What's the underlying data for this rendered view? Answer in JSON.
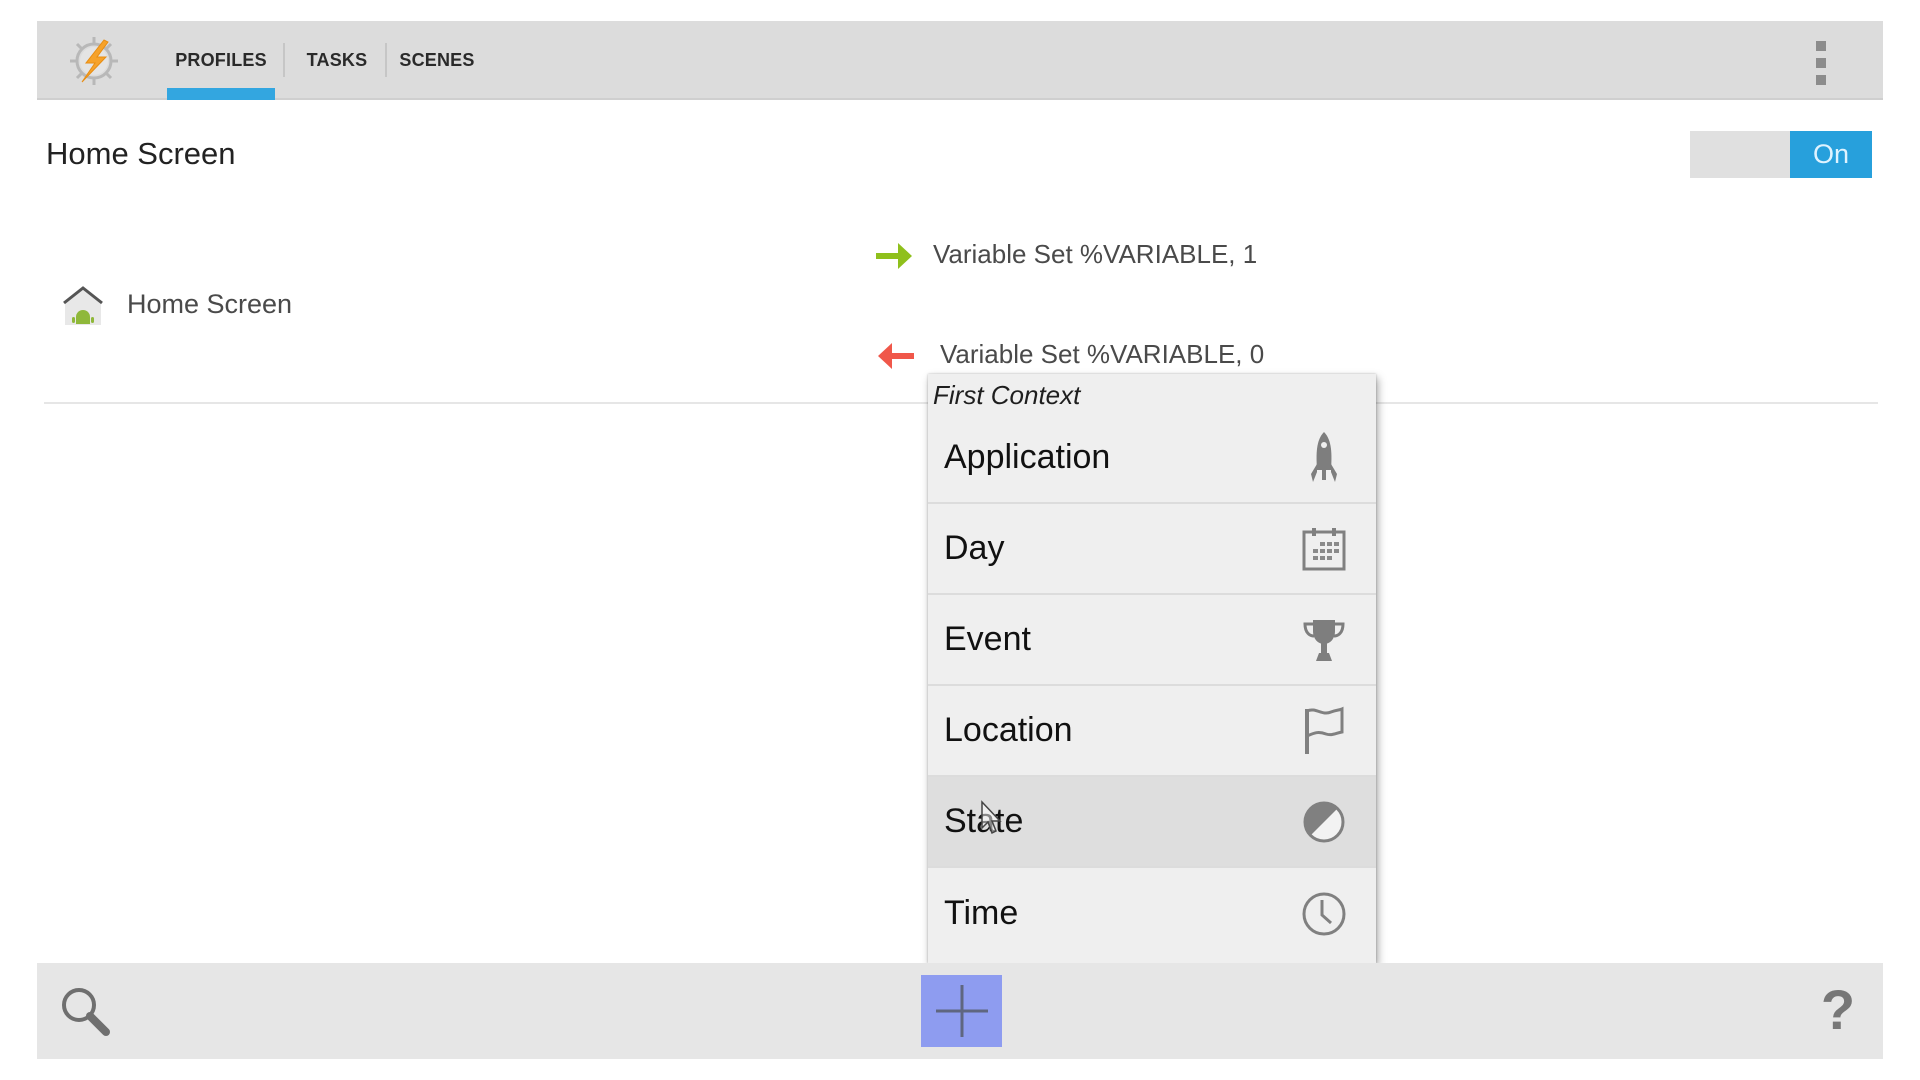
{
  "app": {
    "tabs": [
      {
        "label": "PROFILES",
        "active": true
      },
      {
        "label": "TASKS",
        "active": false
      },
      {
        "label": "SCENES",
        "active": false
      }
    ],
    "accent_color": "#33a6e0",
    "overflow_icon": "more-vert-icon"
  },
  "profile": {
    "title": "Home Screen",
    "toggle_label": "On",
    "toggle_state": true,
    "context": {
      "icon": "home-android-icon",
      "label": "Home Screen"
    },
    "enter_task": {
      "icon": "arrow-right-green-icon",
      "label": "Variable Set %VARIABLE, 1"
    },
    "exit_task": {
      "icon": "arrow-left-red-icon",
      "label": "Variable Set %VARIABLE, 0"
    }
  },
  "popup": {
    "title": "First Context",
    "items": [
      {
        "label": "Application",
        "icon": "rocket-icon"
      },
      {
        "label": "Day",
        "icon": "calendar-icon"
      },
      {
        "label": "Event",
        "icon": "trophy-icon"
      },
      {
        "label": "Location",
        "icon": "flag-icon"
      },
      {
        "label": "State",
        "icon": "half-circle-icon",
        "highlighted": true
      },
      {
        "label": "Time",
        "icon": "clock-icon"
      }
    ]
  },
  "bottombar": {
    "search_icon": "search-icon",
    "add_icon": "plus-icon",
    "help_label": "?"
  }
}
